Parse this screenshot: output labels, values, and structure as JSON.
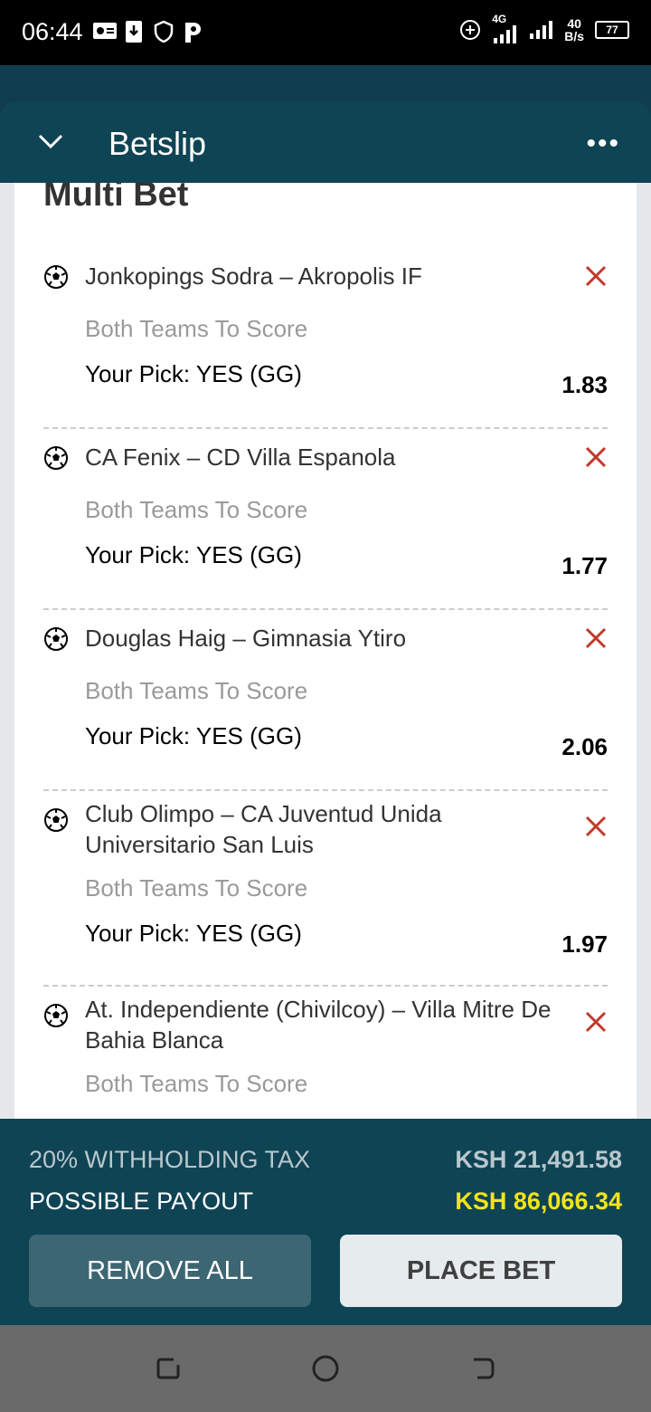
{
  "status_bar": {
    "time": "06:44",
    "network_speed_value": "40",
    "network_speed_unit": "B/s",
    "network_type": "4G",
    "battery": "77",
    "icons": [
      "sim-card-icon",
      "download-icon",
      "shield-icon",
      "p-app-icon",
      "data-saver-icon",
      "signal-icon",
      "signal-icon",
      "battery-icon"
    ]
  },
  "header": {
    "title": "Betslip",
    "more_label": "•••"
  },
  "bets": {
    "section_title": "Multi Bet",
    "items": [
      {
        "match": "Jonkopings Sodra – Akropolis IF",
        "market": "Both Teams To Score",
        "pick": "Your Pick: YES (GG)",
        "odds": "1.83"
      },
      {
        "match": "CA Fenix – CD Villa Espanola",
        "market": "Both Teams To Score",
        "pick": "Your Pick: YES (GG)",
        "odds": "1.77"
      },
      {
        "match": "Douglas Haig – Gimnasia Ytiro",
        "market": "Both Teams To Score",
        "pick": "Your Pick: YES (GG)",
        "odds": "2.06"
      },
      {
        "match": "Club Olimpo – CA Juventud Unida Universitario San Luis",
        "market": "Both Teams To Score",
        "pick": "Your Pick: YES (GG)",
        "odds": "1.97"
      },
      {
        "match": "At. Independiente (Chivilcoy) – Villa Mitre De Bahia Blanca",
        "market": "Both Teams To Score",
        "pick": "",
        "odds": ""
      }
    ]
  },
  "footer": {
    "tax_label": "20% WITHHOLDING TAX",
    "tax_value": "KSH 21,491.58",
    "payout_label": "POSSIBLE PAYOUT",
    "payout_value": "KSH 86,066.34",
    "remove_all_label": "REMOVE ALL",
    "place_bet_label": "PLACE BET"
  },
  "colors": {
    "header_bg": "#0f4455",
    "payout_accent": "#f2e418",
    "remove_icon": "#c0392b"
  }
}
